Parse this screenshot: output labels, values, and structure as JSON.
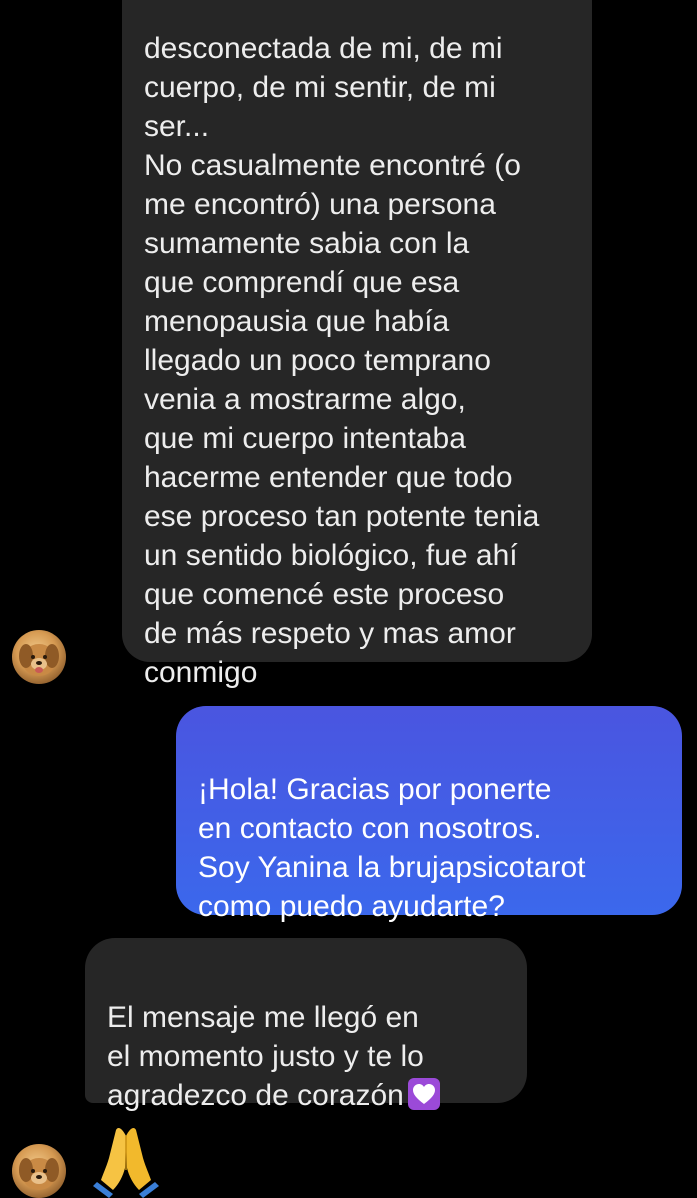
{
  "messages": {
    "long_incoming": {
      "text": "desconectada de mi, de mi\ncuerpo, de mi sentir, de mi\nser...\nNo casualmente encontré (o\nme encontró) una persona\nsumamente sabia con la\nque comprendí que esa\nmenopausia que había\nllegado un poco temprano\nvenia a mostrarme algo,\nque mi cuerpo intentaba\nhacerme entender que todo\nese proceso tan potente tenia\nun sentido biológico, fue ahí\nque comencé este proceso\nde más respeto y mas amor\nconmigo"
    },
    "outgoing": {
      "text": "¡Hola! Gracias por ponerte\nen contacto con nosotros.\nSoy Yanina la brujapsicotarot\ncomo puedo ayudarte?"
    },
    "reply_incoming": {
      "text": "El mensaje me llegó en\nel momento justo y te lo\nagradezco de corazón",
      "emoji": "white-heart-icon"
    },
    "last_incoming": {
      "emoji": "folded-hands-icon"
    }
  },
  "colors": {
    "background": "#000000",
    "incoming_bubble": "#262626",
    "outgoing_bubble_top": "#4a55e0",
    "outgoing_bubble_bottom": "#3b68ec",
    "text_light": "#ededed"
  }
}
